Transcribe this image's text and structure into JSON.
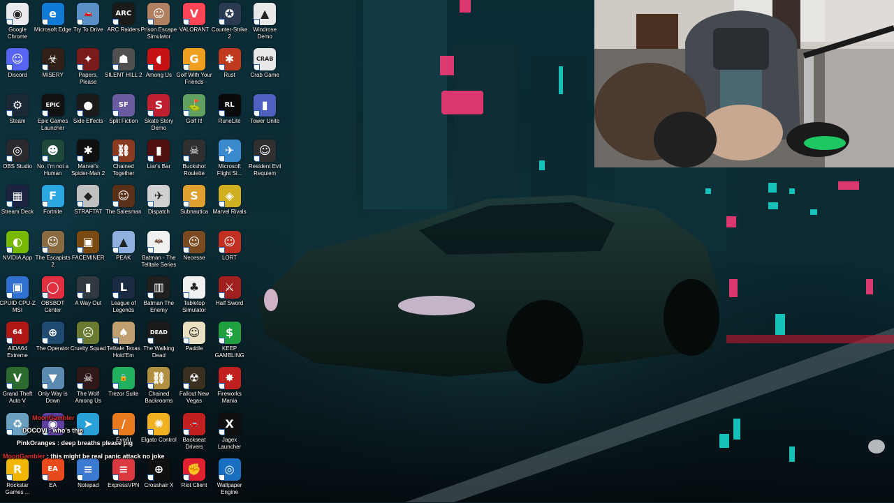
{
  "desktop": {
    "columns": [
      [
        {
          "label": "Google Chrome",
          "icon": "chrome-icon",
          "color": "#e8eaed",
          "glyph": "◉"
        },
        {
          "label": "Discord",
          "icon": "discord-icon",
          "color": "#5865f2",
          "glyph": "☺"
        },
        {
          "label": "Steam",
          "icon": "steam-icon",
          "color": "#1b2838",
          "glyph": "⚙"
        },
        {
          "label": "OBS Studio",
          "icon": "obs-icon",
          "color": "#2a2a2e",
          "glyph": "◎"
        },
        {
          "label": "Stream Deck",
          "icon": "stream-deck-icon",
          "color": "#1c2340",
          "glyph": "▦"
        },
        {
          "label": "NVIDIA App",
          "icon": "nvidia-icon",
          "color": "#76b900",
          "glyph": "◐"
        },
        {
          "label": "CPUID CPU-Z MSI",
          "icon": "cpuz-icon",
          "color": "#3070d0",
          "glyph": "▣"
        },
        {
          "label": "AIDA64 Extreme",
          "icon": "aida64-icon",
          "color": "#b01818",
          "glyph": "64"
        },
        {
          "label": "Grand Theft Auto V",
          "icon": "gta-icon",
          "color": "#2d6a2d",
          "glyph": "V"
        },
        {
          "label": "",
          "icon": "recycle-bin-icon",
          "color": "#6aa0c0",
          "glyph": "♻"
        },
        {
          "label": "Rockstar Games ...",
          "icon": "rockstar-icon",
          "color": "#f2b705",
          "glyph": "R"
        }
      ],
      [
        {
          "label": "Microsoft Edge",
          "icon": "edge-icon",
          "color": "#0f7bd6",
          "glyph": "e"
        },
        {
          "label": "MISERY",
          "icon": "misery-icon",
          "color": "#302018",
          "glyph": "☣"
        },
        {
          "label": "Epic Games Launcher",
          "icon": "epic-icon",
          "color": "#111111",
          "glyph": "EPIC"
        },
        {
          "label": "No, I'm not a Human",
          "icon": "no-im-not-human-icon",
          "color": "#1f4a3a",
          "glyph": "☻"
        },
        {
          "label": "Fortnite",
          "icon": "fortnite-icon",
          "color": "#2aa7e0",
          "glyph": "F"
        },
        {
          "label": "The Escapists 2",
          "icon": "escapists-icon",
          "color": "#8a6a40",
          "glyph": "☺"
        },
        {
          "label": "OBSBOT Center",
          "icon": "obsbot-icon",
          "color": "#e03040",
          "glyph": "◯"
        },
        {
          "label": "The Operator",
          "icon": "operator-icon",
          "color": "#204a70",
          "glyph": "⊕"
        },
        {
          "label": "Only Way is Down",
          "icon": "only-way-down-icon",
          "color": "#5a8ab0",
          "glyph": "▼"
        },
        {
          "label": "",
          "icon": "msi-center-icon",
          "color": "#6040a0",
          "glyph": "◉"
        },
        {
          "label": "EA",
          "icon": "ea-icon",
          "color": "#e84a1c",
          "glyph": "EA"
        }
      ],
      [
        {
          "label": "Try To Drive",
          "icon": "try-to-drive-icon",
          "color": "#5a90c8",
          "glyph": "🚗"
        },
        {
          "label": "Papers, Please",
          "icon": "papers-please-icon",
          "color": "#7a1a1a",
          "glyph": "✦"
        },
        {
          "label": "Side Effects",
          "icon": "side-effects-icon",
          "color": "#1a1a1a",
          "glyph": "●"
        },
        {
          "label": "Marvel's Spider-Man 2",
          "icon": "spiderman-icon",
          "color": "#101010",
          "glyph": "✱"
        },
        {
          "label": "STRAFTAT",
          "icon": "straftat-icon",
          "color": "#c0c0c0",
          "glyph": "◆"
        },
        {
          "label": "FACEMINER",
          "icon": "faceminer-icon",
          "color": "#7a4a10",
          "glyph": "▣"
        },
        {
          "label": "A Way Out",
          "icon": "a-way-out-icon",
          "color": "#303840",
          "glyph": "▮"
        },
        {
          "label": "Cruelty Squad",
          "icon": "cruelty-squad-icon",
          "color": "#6a7a30",
          "glyph": "☹"
        },
        {
          "label": "The Wolf Among Us",
          "icon": "wolf-among-us-icon",
          "color": "#301818",
          "glyph": "☠"
        },
        {
          "label": "",
          "icon": "telegram-icon",
          "color": "#2aa0d8",
          "glyph": "➤"
        },
        {
          "label": "Notepad",
          "icon": "notepad-icon",
          "color": "#3a7ad0",
          "glyph": "≡"
        }
      ],
      [
        {
          "label": "ARC Raiders",
          "icon": "arc-raiders-icon",
          "color": "#1a1a1a",
          "glyph": "ARC"
        },
        {
          "label": "SILENT HILL 2",
          "icon": "silent-hill-icon",
          "color": "#505050",
          "glyph": "☗"
        },
        {
          "label": "Split Fiction",
          "icon": "split-fiction-icon",
          "color": "#6a5aa0",
          "glyph": "SF"
        },
        {
          "label": "Chained Together",
          "icon": "chained-together-icon",
          "color": "#8a3a20",
          "glyph": "⛓"
        },
        {
          "label": "The Salesman",
          "icon": "salesman-icon",
          "color": "#5a3018",
          "glyph": "☺"
        },
        {
          "label": "PEAK",
          "icon": "peak-icon",
          "color": "#90b0e0",
          "glyph": "▲"
        },
        {
          "label": "League of Legends",
          "icon": "league-icon",
          "color": "#1a2a40",
          "glyph": "L"
        },
        {
          "label": "Telltale Texas Hold'Em",
          "icon": "telltale-texas-icon",
          "color": "#c0a070",
          "glyph": "♠"
        },
        {
          "label": "Trezor Suite",
          "icon": "trezor-icon",
          "color": "#20b060",
          "glyph": "🔒"
        },
        {
          "label": "EvoAI",
          "icon": "evoai-icon",
          "color": "#e87a20",
          "glyph": "/"
        },
        {
          "label": "ExpressVPN",
          "icon": "expressvpn-icon",
          "color": "#da3940",
          "glyph": "≡"
        }
      ],
      [
        {
          "label": "Prison Escape Simulator",
          "icon": "prison-escape-icon",
          "color": "#b08060",
          "glyph": "☺"
        },
        {
          "label": "Among Us",
          "icon": "among-us-icon",
          "color": "#c51111",
          "glyph": "◖"
        },
        {
          "label": "Skate Story Demo",
          "icon": "skate-story-icon",
          "color": "#c02030",
          "glyph": "S"
        },
        {
          "label": "Liar's Bar",
          "icon": "liars-bar-icon",
          "color": "#501010",
          "glyph": "▮"
        },
        {
          "label": "Dispatch",
          "icon": "dispatch-icon",
          "color": "#d0d0d0",
          "glyph": "✈"
        },
        {
          "label": "Batman - The Telltale Series",
          "icon": "batman-telltale-icon",
          "color": "#f0f0f0",
          "glyph": "🦇"
        },
        {
          "label": "Batman The Enemy",
          "icon": "batman-enemy-icon",
          "color": "#202020",
          "glyph": "▥"
        },
        {
          "label": "The Walking Dead",
          "icon": "walking-dead-icon",
          "color": "#1a1a1a",
          "glyph": "DEAD"
        },
        {
          "label": "Chained Backrooms",
          "icon": "chained-backrooms-icon",
          "color": "#b09040",
          "glyph": "⛓"
        },
        {
          "label": "Elgato Control",
          "icon": "elgato-icon",
          "color": "#f0b020",
          "glyph": "✺"
        },
        {
          "label": "Crosshair X",
          "icon": "crosshair-icon",
          "color": "#101010",
          "glyph": "⊕"
        }
      ],
      [
        {
          "label": "VALORANT",
          "icon": "valorant-icon",
          "color": "#fd4556",
          "glyph": "V"
        },
        {
          "label": "Golf With Your Friends",
          "icon": "golf-friends-icon",
          "color": "#f0a020",
          "glyph": "G"
        },
        {
          "label": "Golf It!",
          "icon": "golf-it-icon",
          "color": "#60a060",
          "glyph": "⛳"
        },
        {
          "label": "Buckshot Roulette",
          "icon": "buckshot-icon",
          "color": "#303030",
          "glyph": "☠"
        },
        {
          "label": "Subnautica",
          "icon": "subnautica-icon",
          "color": "#e0a030",
          "glyph": "S"
        },
        {
          "label": "Necesse",
          "icon": "necesse-icon",
          "color": "#7a4a20",
          "glyph": "☺"
        },
        {
          "label": "Tabletop Simulator",
          "icon": "tabletop-icon",
          "color": "#f0f0f0",
          "glyph": "♣"
        },
        {
          "label": "Paddle",
          "icon": "paddle-icon",
          "color": "#e8e0c0",
          "glyph": "☺"
        },
        {
          "label": "Fallout New Vegas",
          "icon": "fallout-icon",
          "color": "#3a3020",
          "glyph": "☢"
        },
        {
          "label": "Backseat Drivers",
          "icon": "backseat-drivers-icon",
          "color": "#c02020",
          "glyph": "🚗"
        },
        {
          "label": "Riot Client",
          "icon": "riot-client-icon",
          "color": "#e02030",
          "glyph": "✊"
        }
      ],
      [
        {
          "label": "Counter-Strike 2",
          "icon": "cs2-icon",
          "color": "#2a3a50",
          "glyph": "✪"
        },
        {
          "label": "Rust",
          "icon": "rust-icon",
          "color": "#c03a20",
          "glyph": "✱"
        },
        {
          "label": "RuneLite",
          "icon": "runelite-icon",
          "color": "#0a0a0a",
          "glyph": "RL"
        },
        {
          "label": "Microsoft Flight Si...",
          "icon": "flight-sim-icon",
          "color": "#3a8ad0",
          "glyph": "✈"
        },
        {
          "label": "Marvel Rivals",
          "icon": "marvel-rivals-icon",
          "color": "#d0b020",
          "glyph": "◈"
        },
        {
          "label": "LORT",
          "icon": "lort-icon",
          "color": "#c03020",
          "glyph": "☺"
        },
        {
          "label": "Half Sword",
          "icon": "half-sword-icon",
          "color": "#a02020",
          "glyph": "⚔"
        },
        {
          "label": "KEEP GAMBLING",
          "icon": "keep-gambling-icon",
          "color": "#20a040",
          "glyph": "$"
        },
        {
          "label": "Fireworks Mania",
          "icon": "fireworks-icon",
          "color": "#c02020",
          "glyph": "✸"
        },
        {
          "label": "Jagex Launcher",
          "icon": "jagex-icon",
          "color": "#101010",
          "glyph": "X"
        },
        {
          "label": "Wallpaper Engine",
          "icon": "wallpaper-engine-icon",
          "color": "#1a70c0",
          "glyph": "◎"
        }
      ],
      [
        {
          "label": "Windrose Demo",
          "icon": "windrose-icon",
          "color": "#e8e8e8",
          "glyph": "▲"
        },
        {
          "label": "Crab Game",
          "icon": "crab-game-icon",
          "color": "#e8e8e8",
          "glyph": "CRAB"
        },
        {
          "label": "Tower Unite",
          "icon": "tower-unite-icon",
          "color": "#5060c0",
          "glyph": "▮"
        },
        {
          "label": "Resident Evil Requiem",
          "icon": "resident-evil-icon",
          "color": "#303030",
          "glyph": "☺"
        }
      ]
    ]
  },
  "chat": {
    "messages": [
      {
        "user": "MoonGambler",
        "text": "",
        "color": "#e03030"
      },
      {
        "user": "DOCOVI",
        "text": "who's this",
        "color": "#ffffff"
      },
      {
        "user": "PinkOranges",
        "text": "deep breaths please pig",
        "color": "#ffffff"
      },
      {
        "user": "MoonGambler",
        "text": "this might be real panic attack no joke",
        "color": "#e03030"
      }
    ]
  },
  "colors": {
    "chat_username_red": "#e03030",
    "accent_teal": "#17d3c8",
    "accent_pink": "#ff3a7a"
  }
}
